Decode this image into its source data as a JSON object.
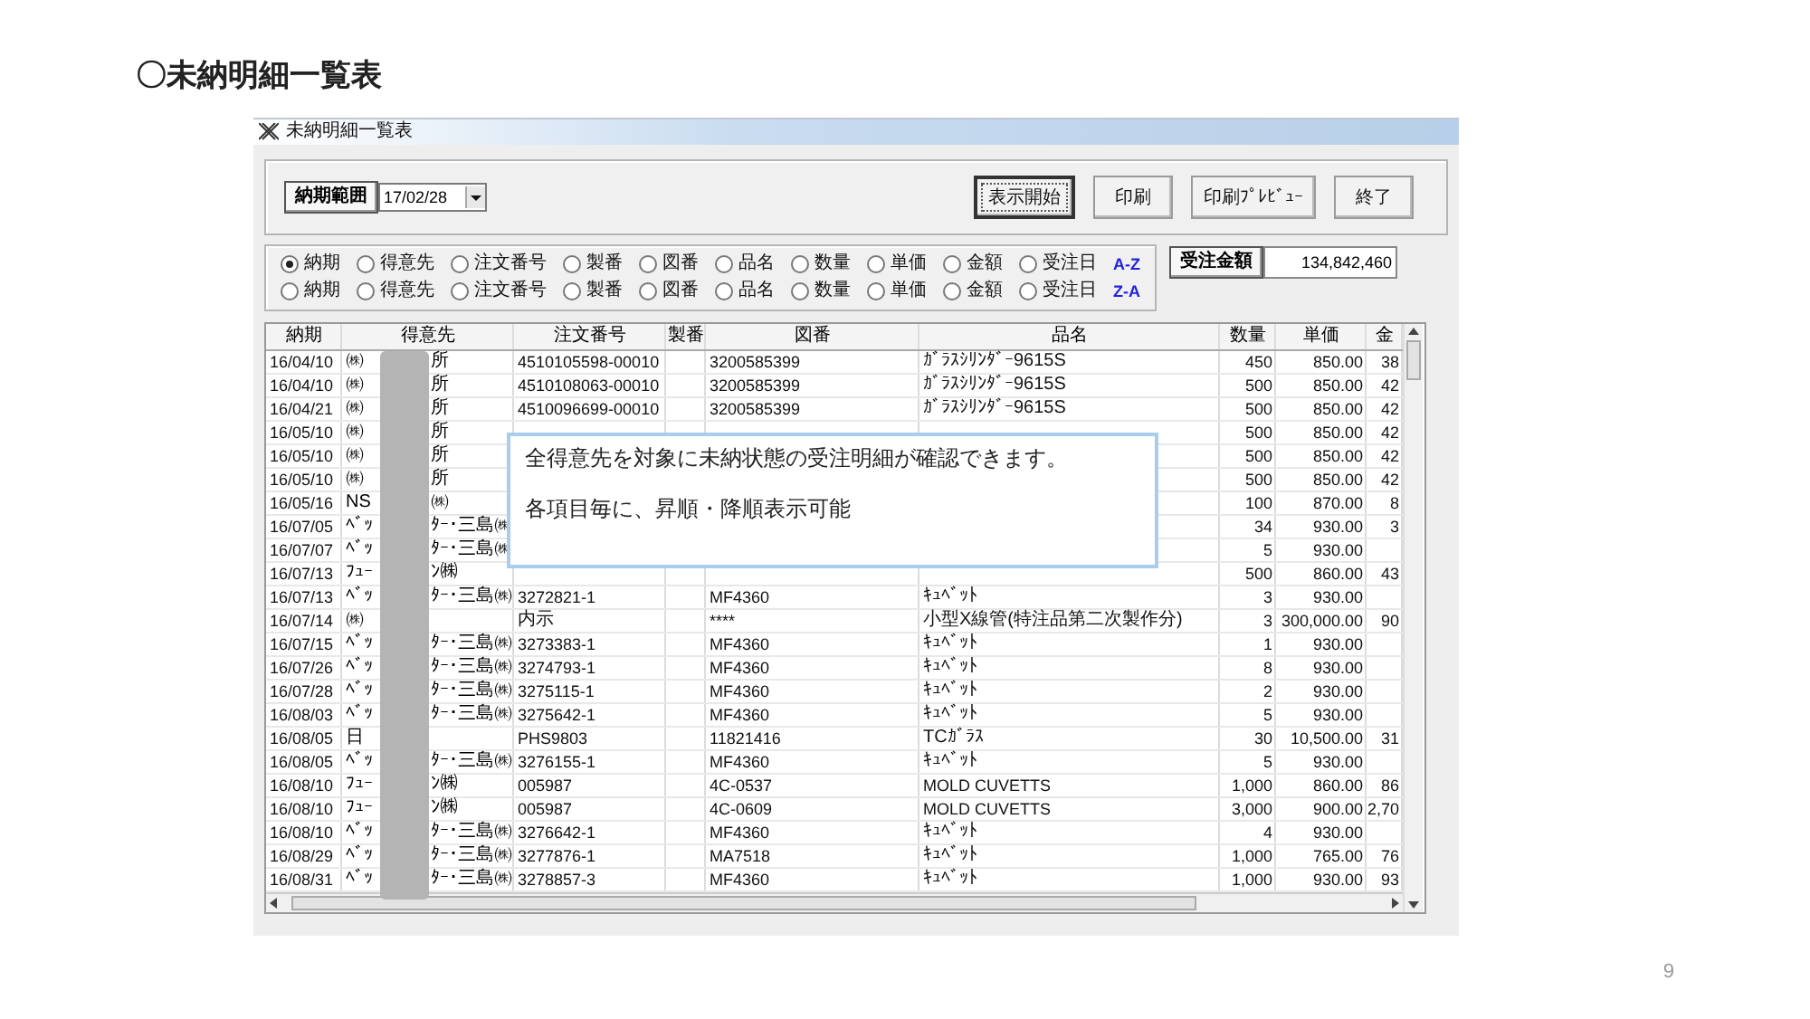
{
  "slide": {
    "title": "〇未納明細一覧表",
    "page_number": "9"
  },
  "window": {
    "title": "未納明細一覧表"
  },
  "toolbar": {
    "range_label": "納期範囲",
    "date": "17/02/28",
    "buttons": [
      {
        "label": "表示開始",
        "focused": true
      },
      {
        "label": "印刷",
        "focused": false
      },
      {
        "label": "印刷ﾌﾟﾚﾋﾞｭｰ",
        "focused": false
      },
      {
        "label": "終了",
        "focused": false
      }
    ]
  },
  "sort": {
    "rows": [
      {
        "direction": "A-Z",
        "options": [
          {
            "label": "納期",
            "selected": true
          },
          {
            "label": "得意先",
            "selected": false
          },
          {
            "label": "注文番号",
            "selected": false
          },
          {
            "label": "製番",
            "selected": false
          },
          {
            "label": "図番",
            "selected": false
          },
          {
            "label": "品名",
            "selected": false
          },
          {
            "label": "数量",
            "selected": false
          },
          {
            "label": "単価",
            "selected": false
          },
          {
            "label": "金額",
            "selected": false
          },
          {
            "label": "受注日",
            "selected": false
          }
        ]
      },
      {
        "direction": "Z-A",
        "options": [
          {
            "label": "納期",
            "selected": false
          },
          {
            "label": "得意先",
            "selected": false
          },
          {
            "label": "注文番号",
            "selected": false
          },
          {
            "label": "製番",
            "selected": false
          },
          {
            "label": "図番",
            "selected": false
          },
          {
            "label": "品名",
            "selected": false
          },
          {
            "label": "数量",
            "selected": false
          },
          {
            "label": "単価",
            "selected": false
          },
          {
            "label": "金額",
            "selected": false
          },
          {
            "label": "受注日",
            "selected": false
          }
        ]
      }
    ]
  },
  "total": {
    "label": "受注金額",
    "value": "134,842,460"
  },
  "table": {
    "columns": [
      "納期",
      "得意先",
      "注文番号",
      "製番",
      "図番",
      "品名",
      "数量",
      "単価",
      "金"
    ],
    "rows": [
      {
        "date": "16/04/10",
        "customer_start": "㈱",
        "customer_end": "所",
        "order_no": "4510105598-00010",
        "drawing_no": "3200585399",
        "item": "ｶﾞﾗｽｼﾘﾝﾀﾞｰ9615S",
        "qty": "450",
        "price": "850.00",
        "amount": "38"
      },
      {
        "date": "16/04/10",
        "customer_start": "㈱",
        "customer_end": "所",
        "order_no": "4510108063-00010",
        "drawing_no": "3200585399",
        "item": "ｶﾞﾗｽｼﾘﾝﾀﾞｰ9615S",
        "qty": "500",
        "price": "850.00",
        "amount": "42"
      },
      {
        "date": "16/04/21",
        "customer_start": "㈱",
        "customer_end": "所",
        "order_no": "4510096699-00010",
        "drawing_no": "3200585399",
        "item": "ｶﾞﾗｽｼﾘﾝﾀﾞｰ9615S",
        "qty": "500",
        "price": "850.00",
        "amount": "42"
      },
      {
        "date": "16/05/10",
        "customer_start": "㈱",
        "customer_end": "所",
        "qty": "500",
        "price": "850.00",
        "amount": "42"
      },
      {
        "date": "16/05/10",
        "customer_start": "㈱",
        "customer_end": "所",
        "qty": "500",
        "price": "850.00",
        "amount": "42"
      },
      {
        "date": "16/05/10",
        "customer_start": "㈱",
        "customer_end": "所",
        "qty": "500",
        "price": "850.00",
        "amount": "42"
      },
      {
        "date": "16/05/16",
        "customer_start": "NS",
        "customer_end": "㈱",
        "qty": "100",
        "price": "870.00",
        "amount": "8"
      },
      {
        "date": "16/07/05",
        "customer_start": "ﾍﾞｯ",
        "customer_end": "ﾀｰ･三島㈱",
        "qty": "34",
        "price": "930.00",
        "amount": "3"
      },
      {
        "date": "16/07/07",
        "customer_start": "ﾍﾞｯ",
        "customer_end": "ﾀｰ･三島㈱",
        "qty": "5",
        "price": "930.00"
      },
      {
        "date": "16/07/13",
        "customer_start": "ﾌｭｰ",
        "customer_end": "ﾝ㈱",
        "qty": "500",
        "price": "860.00",
        "amount": "43"
      },
      {
        "date": "16/07/13",
        "customer_start": "ﾍﾞｯ",
        "customer_end": "ﾀｰ･三島㈱",
        "order_no": "3272821-1",
        "drawing_no": "MF4360",
        "item": "ｷｭﾍﾞｯﾄ",
        "qty": "3",
        "price": "930.00"
      },
      {
        "date": "16/07/14",
        "customer_start": "㈱",
        "order_no": "内示",
        "drawing_no": "****",
        "item": "小型X線管(特注品第二次製作分)",
        "qty": "3",
        "price": "300,000.00",
        "amount": "90"
      },
      {
        "date": "16/07/15",
        "customer_start": "ﾍﾞｯ",
        "customer_end": "ﾀｰ･三島㈱",
        "order_no": "3273383-1",
        "drawing_no": "MF4360",
        "item": "ｷｭﾍﾞｯﾄ",
        "qty": "1",
        "price": "930.00"
      },
      {
        "date": "16/07/26",
        "customer_start": "ﾍﾞｯ",
        "customer_end": "ﾀｰ･三島㈱",
        "order_no": "3274793-1",
        "drawing_no": "MF4360",
        "item": "ｷｭﾍﾞｯﾄ",
        "qty": "8",
        "price": "930.00"
      },
      {
        "date": "16/07/28",
        "customer_start": "ﾍﾞｯ",
        "customer_end": "ﾀｰ･三島㈱",
        "order_no": "3275115-1",
        "drawing_no": "MF4360",
        "item": "ｷｭﾍﾞｯﾄ",
        "qty": "2",
        "price": "930.00"
      },
      {
        "date": "16/08/03",
        "customer_start": "ﾍﾞｯ",
        "customer_end": "ﾀｰ･三島㈱",
        "order_no": "3275642-1",
        "drawing_no": "MF4360",
        "item": "ｷｭﾍﾞｯﾄ",
        "qty": "5",
        "price": "930.00"
      },
      {
        "date": "16/08/05",
        "customer_start": "日",
        "order_no": "PHS9803",
        "drawing_no": "11821416",
        "item": "TCｶﾞﾗｽ",
        "qty": "30",
        "price": "10,500.00",
        "amount": "31"
      },
      {
        "date": "16/08/05",
        "customer_start": "ﾍﾞｯ",
        "customer_end": "ﾀｰ･三島㈱",
        "order_no": "3276155-1",
        "drawing_no": "MF4360",
        "item": "ｷｭﾍﾞｯﾄ",
        "qty": "5",
        "price": "930.00"
      },
      {
        "date": "16/08/10",
        "customer_start": "ﾌｭｰ",
        "customer_end": "ﾝ㈱",
        "order_no": "005987",
        "drawing_no": "4C-0537",
        "item": "MOLD CUVETTS",
        "qty": "1,000",
        "price": "860.00",
        "amount": "86"
      },
      {
        "date": "16/08/10",
        "customer_start": "ﾌｭｰ",
        "customer_end": "ﾝ㈱",
        "order_no": "005987",
        "drawing_no": "4C-0609",
        "item": "MOLD CUVETTS",
        "qty": "3,000",
        "price": "900.00",
        "amount": "2,70"
      },
      {
        "date": "16/08/10",
        "customer_start": "ﾍﾞｯ",
        "customer_end": "ﾀｰ･三島㈱",
        "order_no": "3276642-1",
        "drawing_no": "MF4360",
        "item": "ｷｭﾍﾞｯﾄ",
        "qty": "4",
        "price": "930.00"
      },
      {
        "date": "16/08/29",
        "customer_start": "ﾍﾞｯ",
        "customer_end": "ﾀｰ･三島㈱",
        "order_no": "3277876-1",
        "drawing_no": "MA7518",
        "item": "ｷｭﾍﾞｯﾄ",
        "qty": "1,000",
        "price": "765.00",
        "amount": "76"
      },
      {
        "date": "16/08/31",
        "customer_start": "ﾍﾞｯ",
        "customer_end": "ﾀｰ･三島㈱",
        "order_no": "3278857-3",
        "drawing_no": "MF4360",
        "item": "ｷｭﾍﾞｯﾄ",
        "qty": "1,000",
        "price": "930.00",
        "amount": "93"
      }
    ]
  },
  "callout": {
    "lines": [
      "全得意先を対象に未納状態の受注明細が確認できます。",
      "各項目毎に、昇順・降順表示可能"
    ]
  }
}
